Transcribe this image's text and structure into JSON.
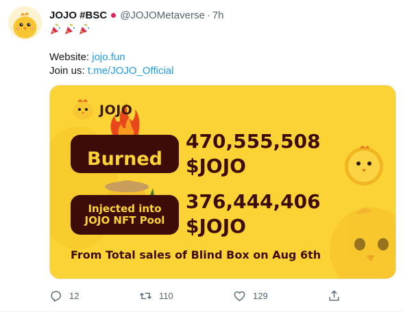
{
  "tweet": {
    "display_name": "JOJO #BSC",
    "handle": "@JOJOMetaverse",
    "separator": "·",
    "time": "7h",
    "icons": {
      "verified_dot": "red-dot-badge",
      "party": "party-popper-icon"
    },
    "line1_label": "Website: ",
    "line1_link": "jojo.fun",
    "line2_label": "Join us: ",
    "line2_link": "t.me/JOJO_Official",
    "colors": {
      "link": "#1d9bf0",
      "card_bg": "#fcd335",
      "dark": "#3d0c08"
    }
  },
  "card": {
    "brand": "JOJO",
    "burned_label": "Burned",
    "burned_amount": "470,555,508",
    "burned_token": "$JOJO",
    "injected_label_line1": "Injected into",
    "injected_label_line2": "JOJO NFT Pool",
    "injected_amount": "376,444,406",
    "injected_token": "$JOJO",
    "footer": "From Total sales of Blind Box on Aug 6th"
  },
  "actions": {
    "replies": "12",
    "retweets": "110",
    "likes": "129"
  }
}
